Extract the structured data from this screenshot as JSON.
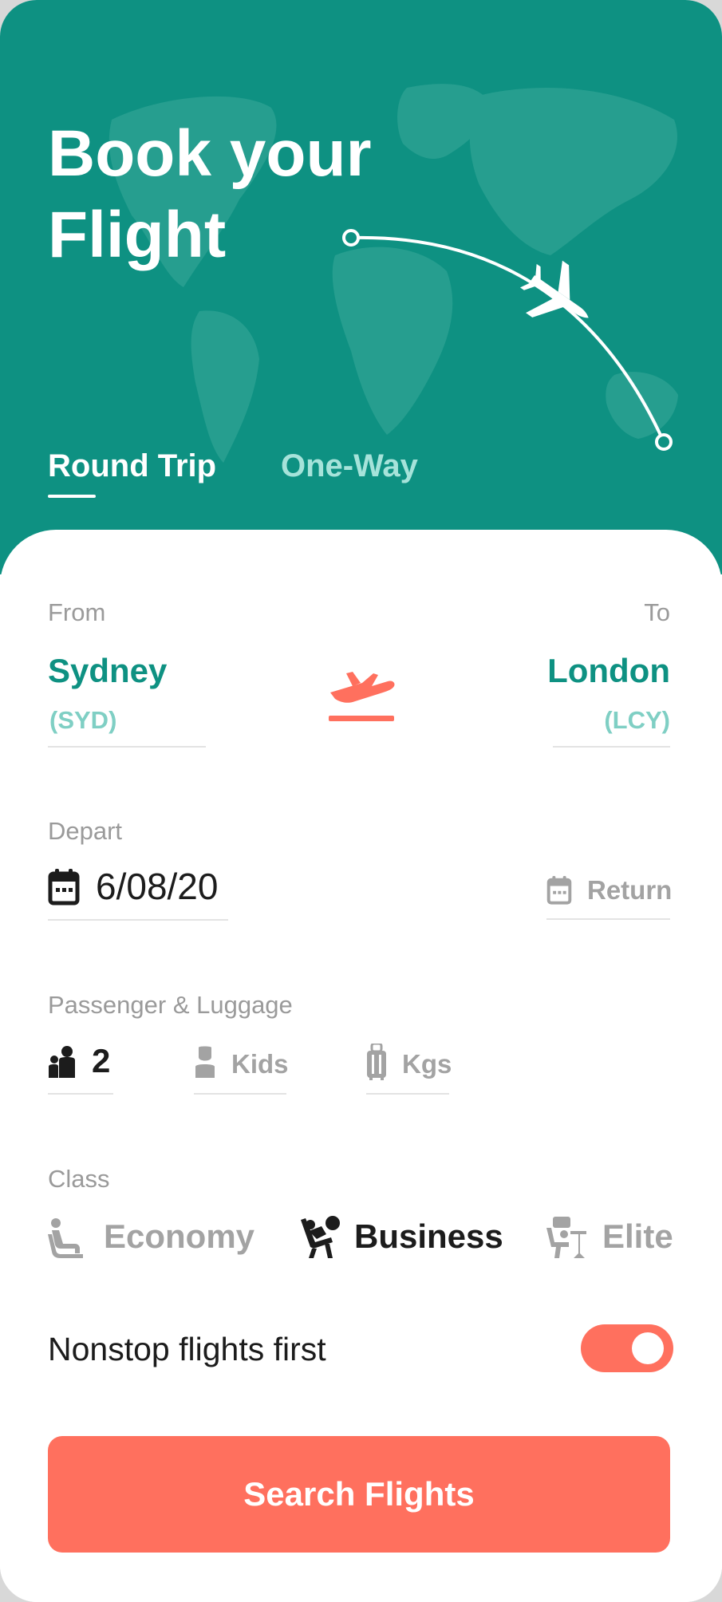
{
  "colors": {
    "teal": "#0e9182",
    "coral": "#ff705e",
    "muted": "#a3a3a3",
    "text": "#1c1c1c"
  },
  "header": {
    "title_line1": "Book  your",
    "title_line2": "Flight"
  },
  "tabs": [
    {
      "label": "Round Trip",
      "active": true
    },
    {
      "label": "One-Way",
      "active": false
    }
  ],
  "route": {
    "from_label": "From",
    "from_city": "Sydney",
    "from_code": "(SYD)",
    "to_label": "To",
    "to_city": "London",
    "to_code": "(LCY)",
    "swap_icon": "plane-takeoff-icon"
  },
  "dates": {
    "depart_label": "Depart",
    "depart_value": "6/08/20",
    "return_placeholder": "Return",
    "icon": "calendar-icon"
  },
  "passengers": {
    "label": "Passenger & Luggage",
    "adults": "2",
    "kids_placeholder": "Kids",
    "luggage_placeholder": "Kgs"
  },
  "class": {
    "label": "Class",
    "options": [
      {
        "label": "Economy",
        "icon": "economy-seat-icon",
        "selected": false
      },
      {
        "label": "Business",
        "icon": "business-seat-icon",
        "selected": true
      },
      {
        "label": "Elite",
        "icon": "elite-seat-icon",
        "selected": false
      }
    ]
  },
  "nonstop": {
    "label": "Nonstop flights first",
    "enabled": true
  },
  "cta": {
    "label": "Search Flights"
  }
}
